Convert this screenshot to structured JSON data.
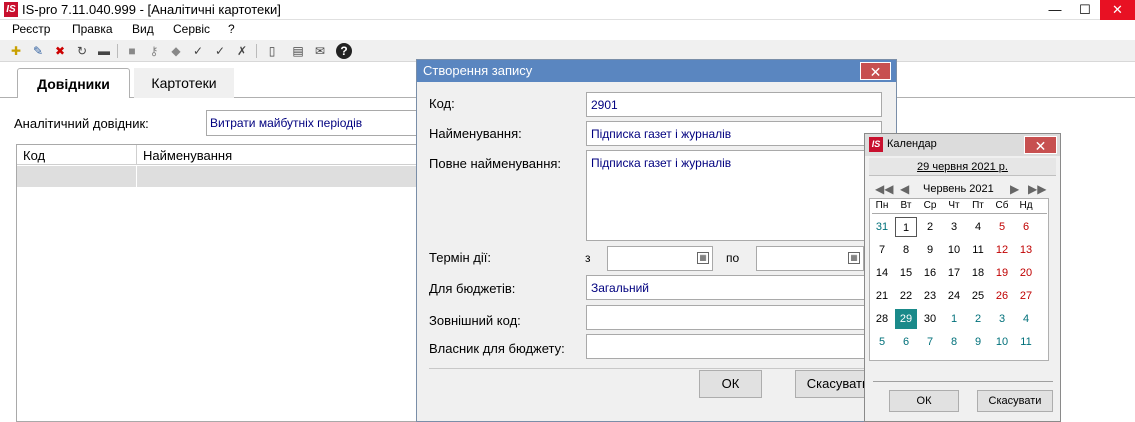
{
  "window": {
    "logo": "IS",
    "title": "IS-pro 7.11.040.999 - [Аналітичні картотеки]",
    "minimize": "—",
    "maximize": "☐",
    "close": "✕"
  },
  "menu": [
    "Реєстр",
    "Правка",
    "Вид",
    "Сервіс",
    "?"
  ],
  "tabs": {
    "active": "Довідники",
    "other": "Картотеки"
  },
  "main": {
    "analytic_label": "Аналітичний довідник:",
    "analytic_value": "Витрати майбутніх періодів",
    "columns": [
      "Код",
      "Найменування"
    ]
  },
  "dialog": {
    "title": "Створення запису",
    "close": "✕",
    "labels": {
      "code": "Код:",
      "name": "Найменування:",
      "full_name": "Повне найменування:",
      "term": "Термін дії:",
      "budgets": "Для бюджетів:",
      "external_code": "Зовнішний код:",
      "owner": "Власник для бюджету:"
    },
    "values": {
      "code": "2901",
      "name": "Підписка газет і журналів",
      "full_name": "Підписка газет і журналів",
      "term_from_prefix": "з",
      "term_to_prefix": "по",
      "budgets": "Загальний"
    },
    "buttons": {
      "ok": "ОК",
      "cancel": "Скасувати"
    }
  },
  "calendar": {
    "logo": "IS",
    "title": "Календар",
    "close": "✕",
    "today_link": "29 червня 2021 р.",
    "month_label": "Червень 2021",
    "weekdays": [
      "Пн",
      "Вт",
      "Ср",
      "Чт",
      "Пт",
      "Сб",
      "Нд"
    ],
    "weeks": [
      [
        "31",
        "1",
        "2",
        "3",
        "4",
        "5",
        "6"
      ],
      [
        "7",
        "8",
        "9",
        "10",
        "11",
        "12",
        "13"
      ],
      [
        "14",
        "15",
        "16",
        "17",
        "18",
        "19",
        "20"
      ],
      [
        "21",
        "22",
        "23",
        "24",
        "25",
        "26",
        "27"
      ],
      [
        "28",
        "29",
        "30",
        "1",
        "2",
        "3",
        "4"
      ],
      [
        "5",
        "6",
        "7",
        "8",
        "9",
        "10",
        "11"
      ]
    ],
    "selected": "29",
    "buttons": {
      "ok": "ОК",
      "cancel": "Скасувати"
    }
  }
}
